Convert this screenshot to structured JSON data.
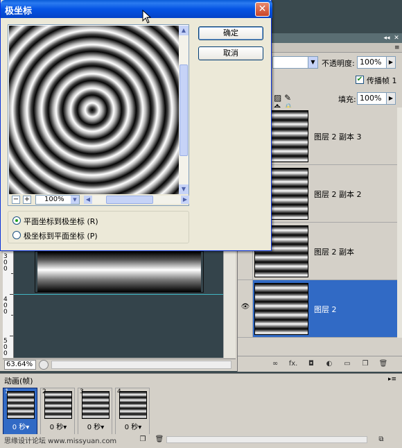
{
  "dialog": {
    "title": "极坐标",
    "close_glyph": "✕",
    "ok_label": "确定",
    "cancel_label": "取消",
    "zoom_value": "100%",
    "zoom_out_glyph": "−",
    "zoom_in_glyph": "+",
    "option_rect_to_polar": "平面坐标到极坐标 (R)",
    "option_polar_to_rect": "极坐标到平面坐标 (P)",
    "selected_option": "rect_to_polar"
  },
  "document": {
    "zoom_level": "63.64%",
    "ruler_numbers": [
      "3",
      "0",
      "0",
      "4",
      "0",
      "0",
      "5",
      "0",
      "0"
    ]
  },
  "layers_panel": {
    "opacity_label": "不透明度:",
    "opacity_value": "100%",
    "propagate_label": "传播帧 1",
    "propagate_checked": true,
    "fill_label": "填充:",
    "fill_value": "100%",
    "lock_icons": "▨ ✎ ✥ 🔒",
    "layers": [
      {
        "name": "图层 2 副本 3",
        "visible": false,
        "selected": false
      },
      {
        "name": "图层 2 副本 2",
        "visible": false,
        "selected": false
      },
      {
        "name": "图层 2 副本",
        "visible": false,
        "selected": false
      },
      {
        "name": "图层 2",
        "visible": true,
        "selected": true
      }
    ],
    "footer_icons": [
      "link-icon",
      "fx-icon",
      "mask-icon",
      "adjustment-icon",
      "folder-icon",
      "new-layer-icon",
      "trash-icon"
    ],
    "footer_glyphs": [
      "∞",
      "fx.",
      "◘",
      "◐",
      "▭",
      "❐",
      "🗑"
    ]
  },
  "animation_panel": {
    "title": "动画(帧)",
    "frames": [
      {
        "number": "1",
        "delay": "0 秒▾",
        "selected": true
      },
      {
        "number": "2",
        "delay": "0 秒▾",
        "selected": false
      },
      {
        "number": "3",
        "delay": "0 秒▾",
        "selected": false
      },
      {
        "number": "4",
        "delay": "0 秒▾",
        "selected": false
      }
    ],
    "watermark": "思缘设计论坛 www.missyuan.com"
  },
  "colors": {
    "xp_title_blue": "#0554e4",
    "selection_blue": "#316ac5",
    "panel_gray": "#d4d0c8",
    "canvas_bg": "#34444b",
    "guide_cyan": "#41b6c4"
  }
}
